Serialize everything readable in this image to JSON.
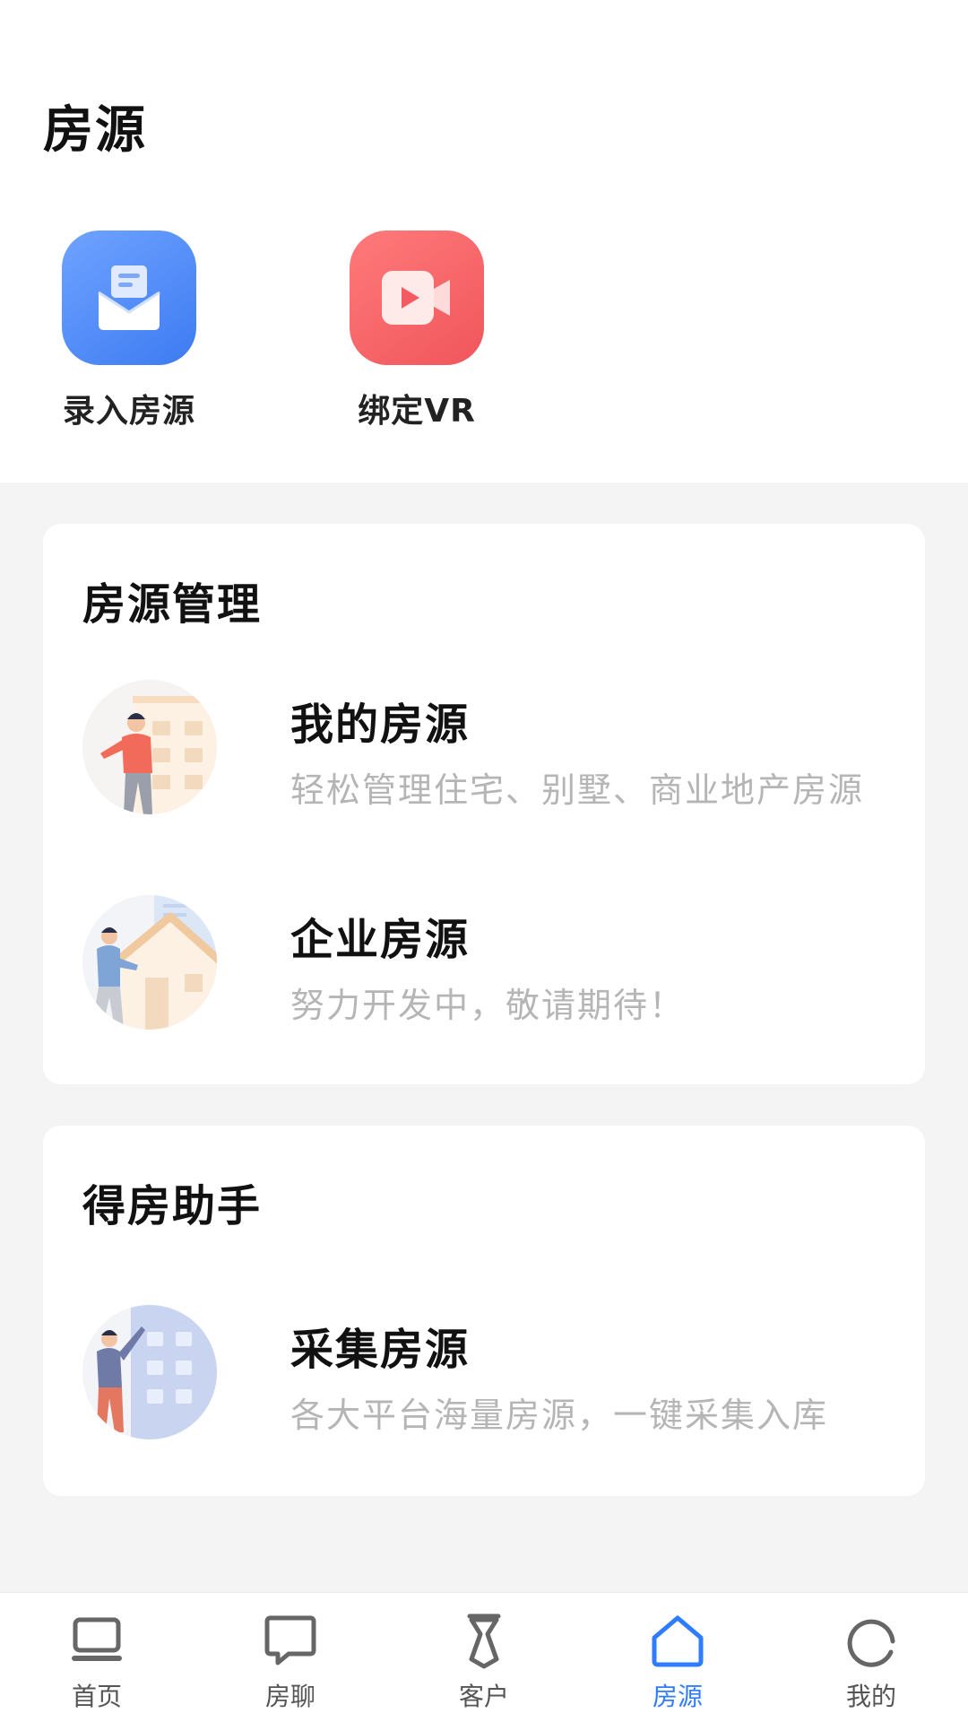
{
  "page_title": "房源",
  "quick_actions": [
    {
      "label": "录入房源",
      "icon": "mail-document-icon",
      "color": "#3d7bf2"
    },
    {
      "label": "绑定VR",
      "icon": "video-play-icon",
      "color": "#f0565c"
    }
  ],
  "management_card": {
    "title": "房源管理",
    "items": [
      {
        "title": "我的房源",
        "subtitle": "轻松管理住宅、别墅、商业地产房源",
        "icon": "agent-building-illustration"
      },
      {
        "title": "企业房源",
        "subtitle": "努力开发中，敬请期待！",
        "icon": "agent-house-illustration"
      }
    ]
  },
  "assistant_card": {
    "title": "得房助手",
    "items": [
      {
        "title": "采集房源",
        "subtitle": "各大平台海量房源，一键采集入库",
        "icon": "agent-collect-illustration"
      }
    ]
  },
  "tabbar": {
    "active_color": "#2f7dff",
    "items": [
      {
        "label": "首页",
        "icon": "laptop-icon",
        "active": false
      },
      {
        "label": "房聊",
        "icon": "chat-bubble-icon",
        "active": false
      },
      {
        "label": "客户",
        "icon": "tie-icon",
        "active": false
      },
      {
        "label": "房源",
        "icon": "house-icon",
        "active": true
      },
      {
        "label": "我的",
        "icon": "profile-circle-icon",
        "active": false
      }
    ]
  }
}
